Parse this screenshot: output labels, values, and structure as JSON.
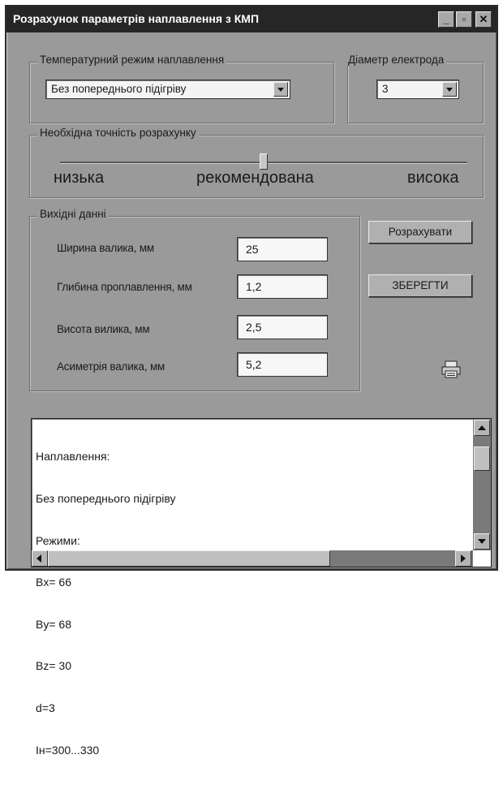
{
  "window": {
    "title": "Розрахунок параметрів наплавлення з КМП",
    "controls": {
      "minimize": "_",
      "maximize": "▫",
      "close": "✕"
    }
  },
  "temperature_group": {
    "legend": "Температурний режим наплавлення",
    "selected": "Без попереднього підігріву"
  },
  "diameter_group": {
    "legend": "Діаметр електрода",
    "selected": "3"
  },
  "accuracy_group": {
    "legend": "Необхідна точність розрахунку",
    "labels": {
      "low": "низька",
      "recommended": "рекомендована",
      "high": "висока"
    },
    "level": 0.5
  },
  "input_group": {
    "legend": "Вихідні данні",
    "fields": [
      {
        "label": "Ширина валика, мм",
        "value": "25"
      },
      {
        "label": "Глибина проплавлення, мм",
        "value": "1,2"
      },
      {
        "label": "Висота вилика, мм",
        "value": "2,5"
      },
      {
        "label": "Асиметрія валика, мм",
        "value": "5,2"
      }
    ]
  },
  "buttons": {
    "calculate": "Розрахувати",
    "save": "ЗБЕРЕГТИ",
    "print_icon": "printer-icon"
  },
  "output": {
    "lines": [
      "Наплавлення:",
      "Без попереднього підігріву",
      "Режими:",
      "Bx= 66",
      "By= 68",
      "Bz= 30",
      "d=3",
      "Iн=300...330"
    ]
  }
}
